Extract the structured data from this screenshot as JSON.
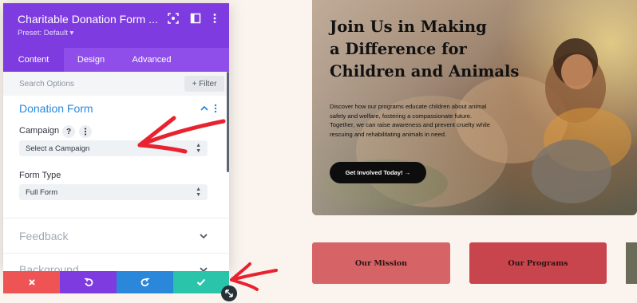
{
  "module": {
    "title": "Charitable Donation Form ...",
    "preset": "Preset: Default ▾",
    "header_icons": [
      "focus-icon",
      "split-view-icon",
      "more-icon"
    ]
  },
  "tabs": [
    {
      "label": "Content",
      "active": true
    },
    {
      "label": "Design",
      "active": false
    },
    {
      "label": "Advanced",
      "active": false
    }
  ],
  "search": {
    "placeholder": "Search Options",
    "filter_label": "+ Filter"
  },
  "donation_form": {
    "title": "Donation Form",
    "campaign": {
      "label": "Campaign",
      "help": "?",
      "value": "Select a Campaign"
    },
    "form_type": {
      "label": "Form Type",
      "value": "Full Form"
    }
  },
  "collapsed_sections": [
    "Feedback",
    "Background"
  ],
  "action_bar": {
    "close": "close-icon",
    "undo": "undo-icon",
    "redo": "redo-icon",
    "save": "check-icon"
  },
  "colors": {
    "panel_header": "#7e3be0",
    "tabs_bg": "#8f4eea",
    "accent_blue": "#2b87da",
    "close_red": "#ef5454",
    "save_green": "#29c4a9",
    "annotation_red": "#e8232f"
  },
  "hero": {
    "title_line1": "Join Us in Making",
    "title_line2": "a Difference for",
    "title_line3": "Children and Animals",
    "description": "Discover how our programs educate children about animal safety and welfare, fostering a compassionate future. Together, we can raise awareness and prevent cruelty while rescuing and rehabilitating animals in need.",
    "cta": "Get Involved Today! →"
  },
  "cards": [
    "Our Mission",
    "Our Programs"
  ]
}
